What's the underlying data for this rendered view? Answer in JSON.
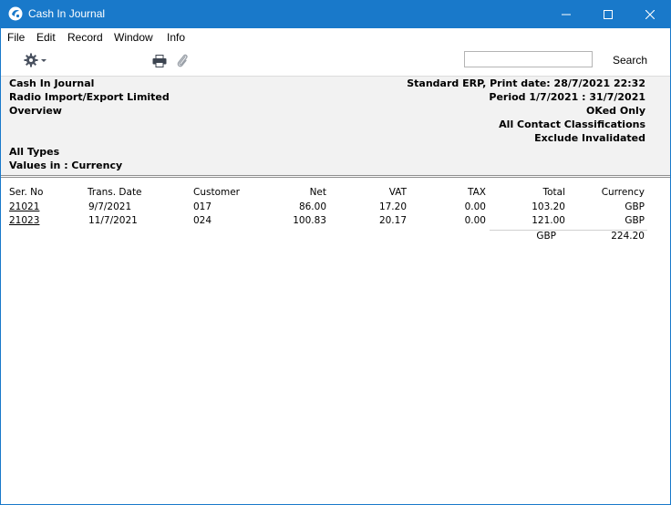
{
  "window": {
    "title": "Cash In Journal"
  },
  "menu": [
    "File",
    "Edit",
    "Record",
    "Window",
    "Info"
  ],
  "toolbar": {
    "search_label": "Search",
    "search_value": ""
  },
  "report": {
    "left": [
      "Cash In Journal",
      "Radio Import/Export Limited",
      "Overview",
      "All Types",
      "Values in : Currency"
    ],
    "right": [
      "Standard ERP, Print date: 28/7/2021 22:32",
      "Period  1/7/2021 : 31/7/2021",
      "OKed Only",
      "All Contact Classifications",
      "Exclude  Invalidated"
    ]
  },
  "table": {
    "headers": [
      "Ser. No",
      "Trans. Date",
      "Customer",
      "Net",
      "VAT",
      "TAX",
      "Total",
      "Currency"
    ],
    "rows": [
      [
        "21021",
        "9/7/2021",
        "017",
        "86.00",
        "17.20",
        "0.00",
        "103.20",
        "GBP"
      ],
      [
        "21023",
        "11/7/2021",
        "024",
        "100.83",
        "20.17",
        "0.00",
        "121.00",
        "GBP"
      ]
    ],
    "total": {
      "currency": "GBP",
      "amount": "224.20"
    }
  }
}
